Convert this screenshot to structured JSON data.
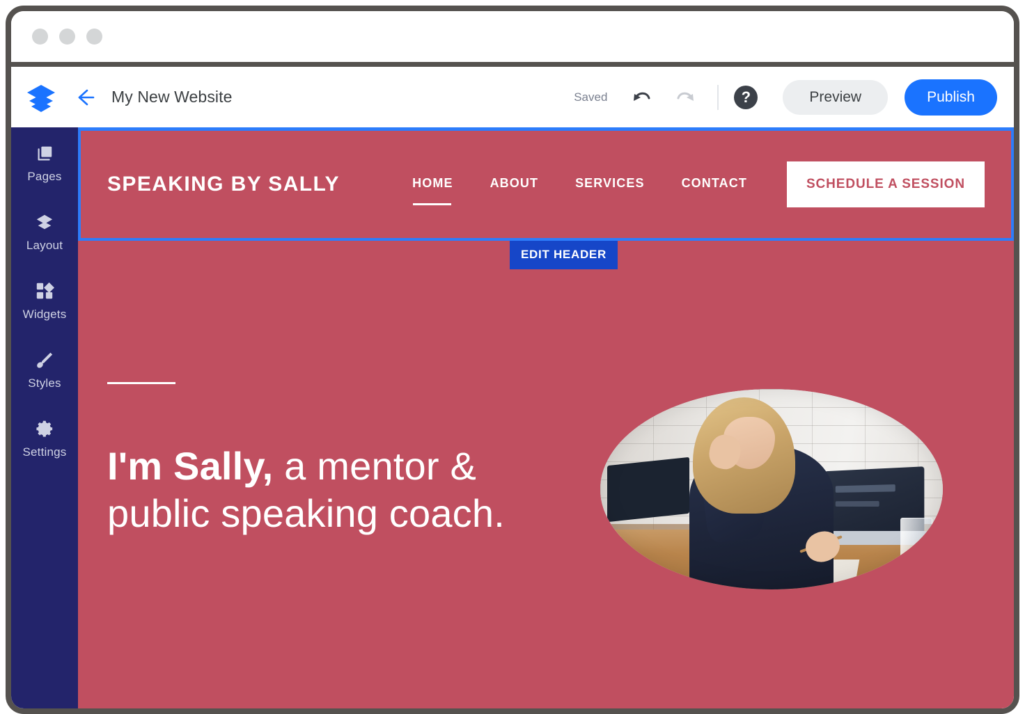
{
  "window": {
    "dots": [
      "dot-1",
      "dot-2",
      "dot-3"
    ]
  },
  "toolbar": {
    "logo_icon": "layers-icon",
    "back_icon": "back-arrow-icon",
    "site_title": "My New Website",
    "saved_label": "Saved",
    "undo_icon": "undo-icon",
    "redo_icon": "redo-icon",
    "help_icon": "question-mark-icon",
    "help_glyph": "?",
    "preview_label": "Preview",
    "publish_label": "Publish",
    "publish_color": "#1a73ff",
    "preview_color": "#eceef0"
  },
  "sidebar": {
    "background": "#23246b",
    "items": [
      {
        "label": "Pages",
        "icon": "pages-icon"
      },
      {
        "label": "Layout",
        "icon": "layers-diamond-icon"
      },
      {
        "label": "Widgets",
        "icon": "widgets-grid-icon"
      },
      {
        "label": "Styles",
        "icon": "paintbrush-icon"
      },
      {
        "label": "Settings",
        "icon": "gear-icon"
      }
    ]
  },
  "canvas": {
    "background": "#c04f60",
    "selection_color": "#2d7dfb",
    "edit_badge": "EDIT HEADER",
    "site_header": {
      "brand": "SPEAKING BY SALLY",
      "nav": [
        {
          "label": "HOME",
          "active": true
        },
        {
          "label": "ABOUT",
          "active": false
        },
        {
          "label": "SERVICES",
          "active": false
        },
        {
          "label": "CONTACT",
          "active": false
        }
      ],
      "cta_label": "SCHEDULE A SESSION"
    },
    "hero": {
      "rule": "divider-line",
      "title_line1_bold": "I'm Sally,",
      "title_line1_rest": " a mentor &",
      "title_line2": "public speaking coach.",
      "photo_alt": "woman-on-phone-at-desk-photo"
    }
  }
}
